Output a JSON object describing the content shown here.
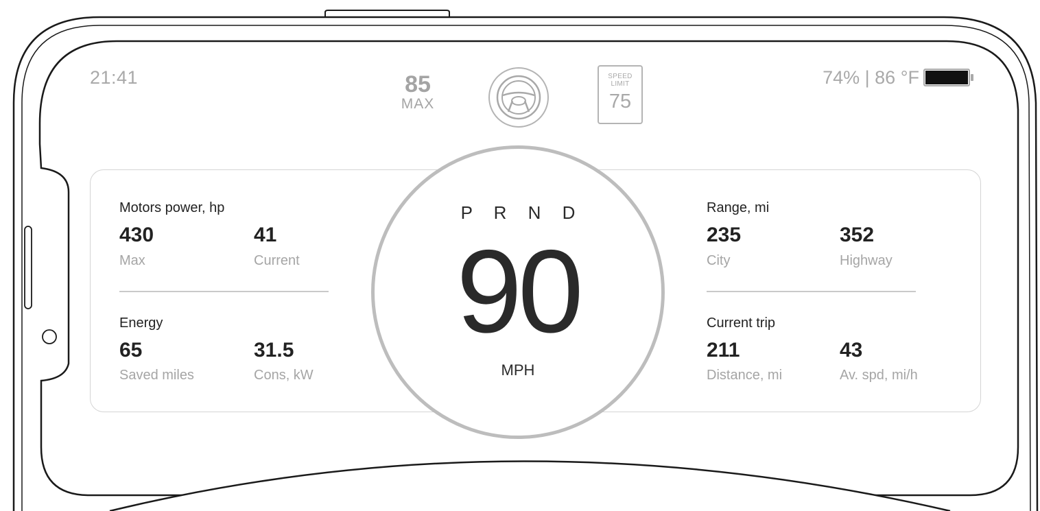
{
  "status_bar": {
    "time": "21:41",
    "max_speed": {
      "value": "85",
      "label": "MAX"
    },
    "speed_limit": {
      "line1": "SPEED",
      "line2": "LIMIT",
      "value": "75"
    },
    "battery_temp": "74% | 86 °F",
    "battery_level_fraction": 0.74
  },
  "drive": {
    "gears": "P R N D",
    "speed": "90",
    "unit": "MPH"
  },
  "motors_power": {
    "title": "Motors power, hp",
    "items": [
      {
        "value": "430",
        "label": "Max"
      },
      {
        "value": "41",
        "label": "Current"
      }
    ]
  },
  "energy": {
    "title": "Energy",
    "items": [
      {
        "value": "65",
        "label": "Saved miles"
      },
      {
        "value": "31.5",
        "label": "Cons, kW"
      }
    ]
  },
  "range": {
    "title": "Range, mi",
    "items": [
      {
        "value": "235",
        "label": "City"
      },
      {
        "value": "352",
        "label": "Highway"
      }
    ]
  },
  "current_trip": {
    "title": "Current trip",
    "items": [
      {
        "value": "211",
        "label": "Distance, mi"
      },
      {
        "value": "43",
        "label": "Av. spd, mi/h"
      }
    ]
  },
  "colors": {
    "text_dark": "#222222",
    "text_muted": "#a5a5a5",
    "outline": "#1a1a1a",
    "dial_ring": "#bdbdbd"
  }
}
